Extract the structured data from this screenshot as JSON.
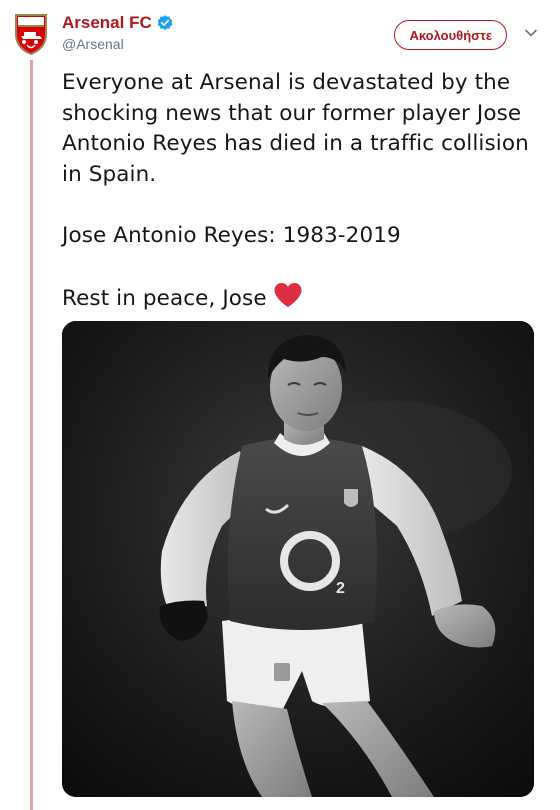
{
  "account": {
    "display_name": "Arsenal FC",
    "handle": "@Arsenal",
    "verified": true,
    "brand_color": "#b0171f"
  },
  "follow_button": {
    "label": "Ακολουθήστε"
  },
  "tweet": {
    "paragraphs": [
      "Everyone at Arsenal is devastated by the shocking news that our former player Jose Antonio Reyes has died in a traffic collision in Spain.",
      "Jose Antonio Reyes: 1983-2019",
      "Rest in peace, Jose"
    ],
    "emoji": "red-heart-icon"
  },
  "media": {
    "type": "photo",
    "style": "black-and-white",
    "shirt_sponsor": "O2"
  },
  "icons": {
    "avatar": "arsenal-crest-icon",
    "verified": "verified-badge-icon",
    "menu": "chevron-down-icon"
  },
  "colors": {
    "thread_line": "#d9a6a6",
    "text": "#14171a",
    "secondary_text": "#657786",
    "verified": "#1da1f2",
    "heart": "#e0245e"
  }
}
